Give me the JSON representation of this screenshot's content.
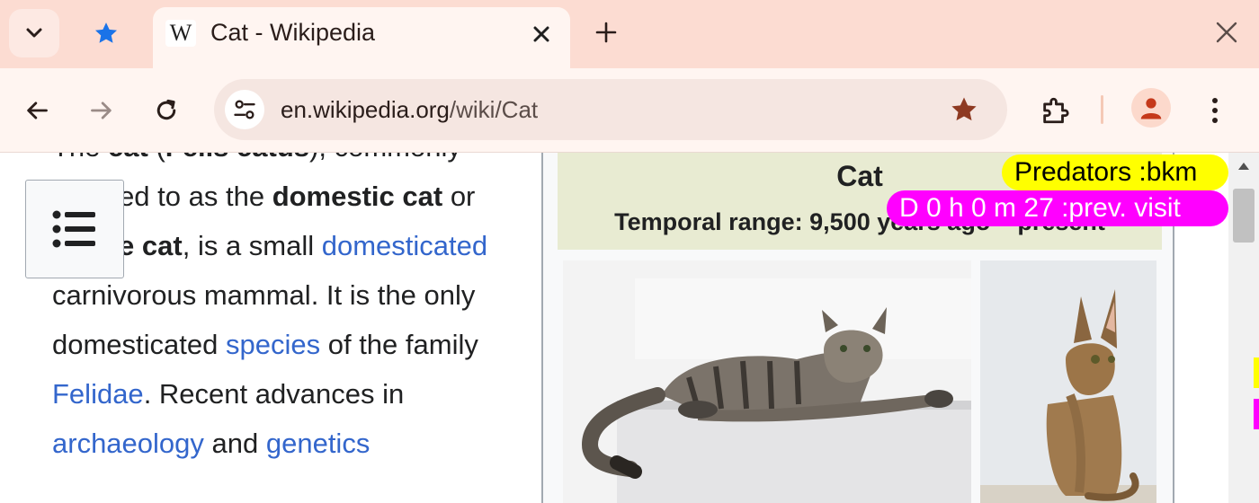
{
  "browser": {
    "tab": {
      "title": "Cat - Wikipedia",
      "favicon": "W"
    },
    "address": {
      "host": "en.wikipedia.org",
      "path": "/wiki/Cat"
    },
    "accent_color": "#b5472a",
    "bookmark_color": "#8e3a22"
  },
  "article": {
    "p1": "The ",
    "bold1": "cat",
    "p2": " (",
    "bold2": "Felis catus",
    "p3": "), commonly referred to as the ",
    "bold3": "domestic cat",
    "p4": " or ",
    "bold4": "house cat",
    "p5": ", is a small ",
    "link1": "domesticated",
    "p6": " carnivorous mammal. It is the only domesticated ",
    "link2": "species",
    "p7": " of the family ",
    "link3": "Felidae",
    "p8": ". Recent advances in ",
    "link4": "archaeology",
    "p9": " and ",
    "link5": "genetics"
  },
  "infobox": {
    "title": "Cat",
    "range": "Temporal range: 9,500 years ago – present"
  },
  "overlays": {
    "predators": "Predators :bkm",
    "visit": "D 0 h 0 m 27 :prev. visit"
  }
}
